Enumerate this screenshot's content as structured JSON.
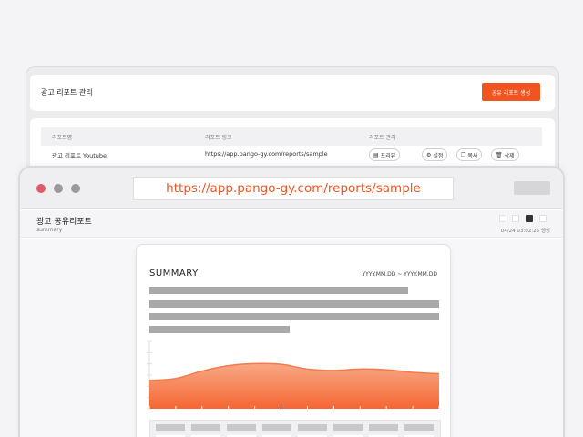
{
  "admin": {
    "title": "광고 리포트 관리",
    "create_button": "공유 리포트 생성",
    "columns": [
      "리포트명",
      "리포트 링크",
      "리포트 관리"
    ],
    "row": {
      "name": "광고 리포트 Youtube",
      "link": "https://app.pango-gy.com/reports/sample",
      "actions": [
        "프리뷰",
        "설정",
        "복사",
        "삭제"
      ]
    }
  },
  "browser": {
    "url": "https://app.pango-gy.com/reports/sample"
  },
  "report": {
    "title": "광고 공유리포트",
    "subtitle": "summary",
    "timestamp": "04/24 03:02:25 생성",
    "summary_title": "SUMMARY",
    "date_range": "YYYY.MM.DD ~ YYYY.MM.DD"
  },
  "chart_data": {
    "type": "area",
    "x": [
      0,
      1,
      2,
      3,
      4,
      5,
      6,
      7,
      8,
      9,
      10,
      11
    ],
    "values": [
      42,
      45,
      56,
      64,
      67,
      66,
      59,
      57,
      59,
      58,
      54,
      52
    ],
    "ylim": [
      0,
      100
    ],
    "color": "#f47a4a"
  },
  "colors": {
    "accent": "#f2541f",
    "dot_red": "#e05a6a",
    "dot_gray": "#9a9a9e"
  }
}
